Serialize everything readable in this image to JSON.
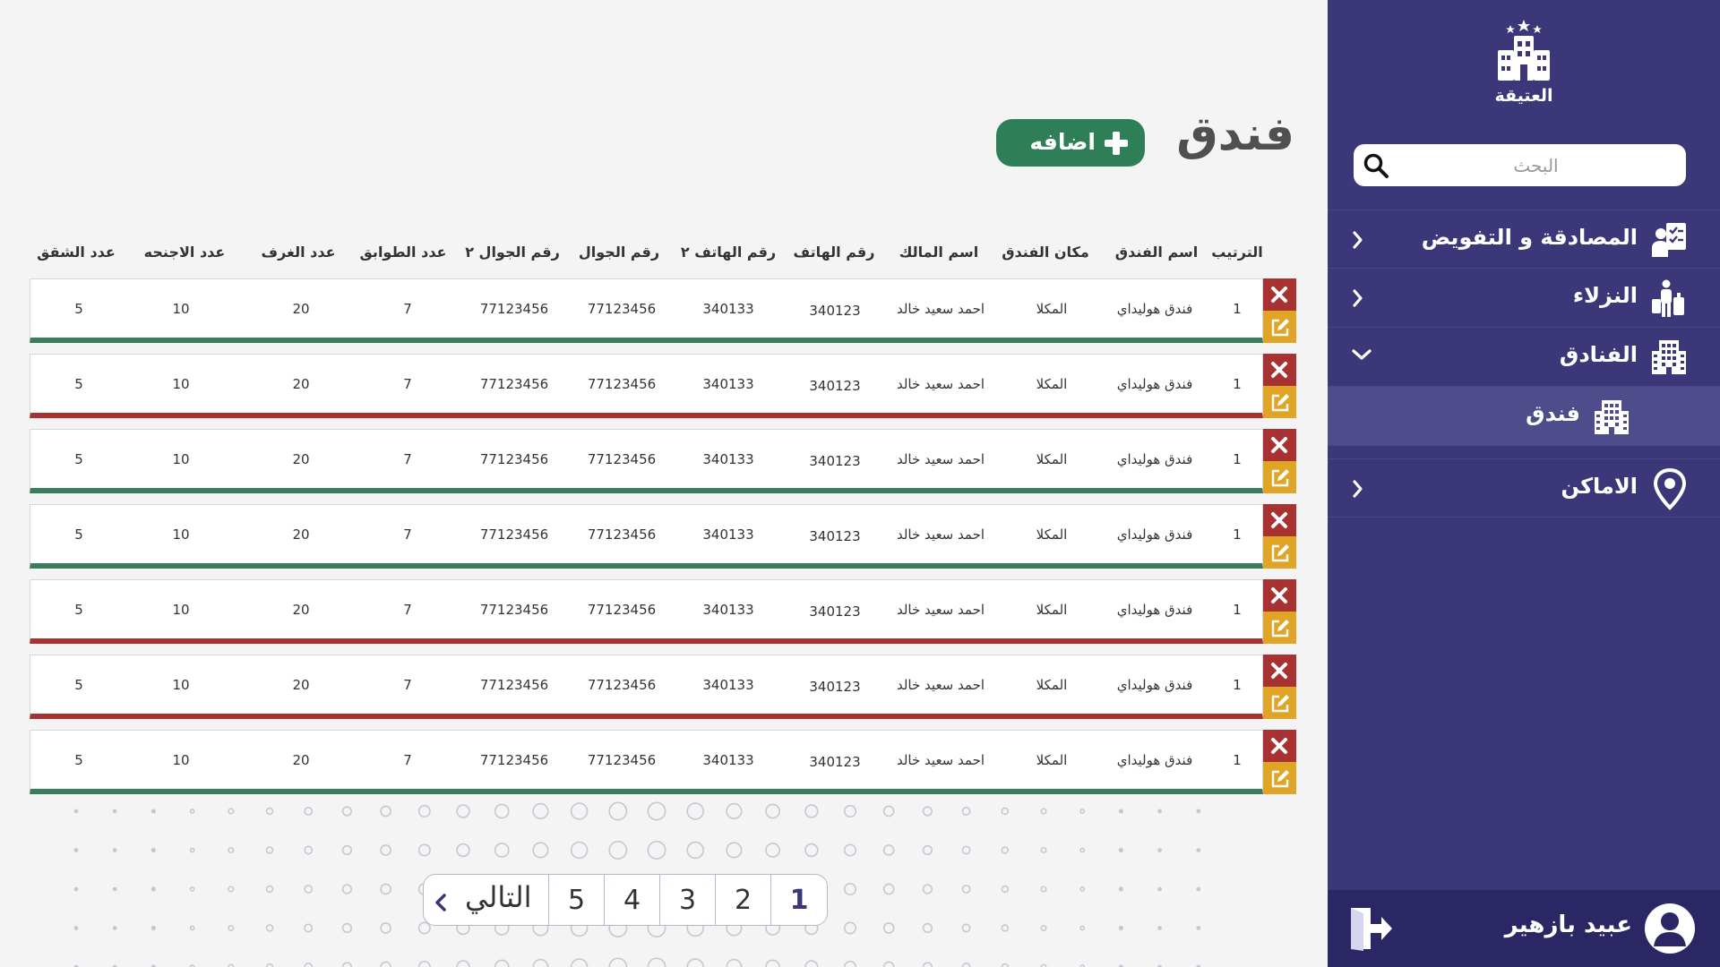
{
  "sidebar": {
    "logo_text": "العتيقة",
    "search": {
      "placeholder": "البحث",
      "value": ""
    },
    "items": [
      {
        "label": "المصادقة و التفويض",
        "icon": "authorization-icon",
        "chevron": "chevron-left-icon"
      },
      {
        "label": "النزلاء",
        "icon": "guest-luggage-icon",
        "chevron": "chevron-left-icon"
      },
      {
        "label": "الفنادق",
        "icon": "hotel-building-icon",
        "chevron": "chevron-down-icon"
      },
      {
        "label": "فندق",
        "icon": "hotel-building-icon",
        "sub": true
      },
      {
        "label": "الاماكن",
        "icon": "location-pin-icon",
        "chevron": "chevron-left-icon"
      }
    ],
    "user": {
      "name": "عبيد بازهير",
      "avatar_icon": "user-avatar-icon",
      "logout_icon": "logout-icon"
    }
  },
  "page": {
    "title": "فندق",
    "add_button": "اضافه"
  },
  "table": {
    "headers": [
      "الترتيب",
      "اسم الفندق",
      "مكان الفندق",
      "اسم المالك",
      "رقم الهاتف",
      "رقم الهاتف ٢",
      "رقم الجوال",
      "رقم الجوال ٢",
      "عدد الطوابق",
      "عدد الغرف",
      "عدد الاجنحه",
      "عدد الشقق"
    ],
    "rows": [
      {
        "cells": [
          "1",
          "فندق هوليداي",
          "المكلا",
          "احمد سعيد خالد",
          "340123",
          "340133",
          "77123456",
          "77123456",
          "7",
          "20",
          "10",
          "5"
        ],
        "status": "green"
      },
      {
        "cells": [
          "1",
          "فندق هوليداي",
          "المكلا",
          "احمد سعيد خالد",
          "340123",
          "340133",
          "77123456",
          "77123456",
          "7",
          "20",
          "10",
          "5"
        ],
        "status": "red"
      },
      {
        "cells": [
          "1",
          "فندق هوليداي",
          "المكلا",
          "احمد سعيد خالد",
          "340123",
          "340133",
          "77123456",
          "77123456",
          "7",
          "20",
          "10",
          "5"
        ],
        "status": "green"
      },
      {
        "cells": [
          "1",
          "فندق هوليداي",
          "المكلا",
          "احمد سعيد خالد",
          "340123",
          "340133",
          "77123456",
          "77123456",
          "7",
          "20",
          "10",
          "5"
        ],
        "status": "green"
      },
      {
        "cells": [
          "1",
          "فندق هوليداي",
          "المكلا",
          "احمد سعيد خالد",
          "340123",
          "340133",
          "77123456",
          "77123456",
          "7",
          "20",
          "10",
          "5"
        ],
        "status": "red"
      },
      {
        "cells": [
          "1",
          "فندق هوليداي",
          "المكلا",
          "احمد سعيد خالد",
          "340123",
          "340133",
          "77123456",
          "77123456",
          "7",
          "20",
          "10",
          "5"
        ],
        "status": "red"
      },
      {
        "cells": [
          "1",
          "فندق هوليداي",
          "المكلا",
          "احمد سعيد خالد",
          "340123",
          "340133",
          "77123456",
          "77123456",
          "7",
          "20",
          "10",
          "5"
        ],
        "status": "green"
      }
    ]
  },
  "pagination": {
    "pages": [
      "1",
      "2",
      "3",
      "4",
      "5"
    ],
    "active": "1",
    "next_label": "التالي"
  },
  "colors": {
    "sidebar_bg": "#3b3779",
    "user_bar_bg": "#2a2764",
    "add_button": "#2e7f57",
    "status_green": "#3a7d5c",
    "status_red": "#a83232",
    "delete_action": "#a83232",
    "edit_action": "#e0a526"
  }
}
